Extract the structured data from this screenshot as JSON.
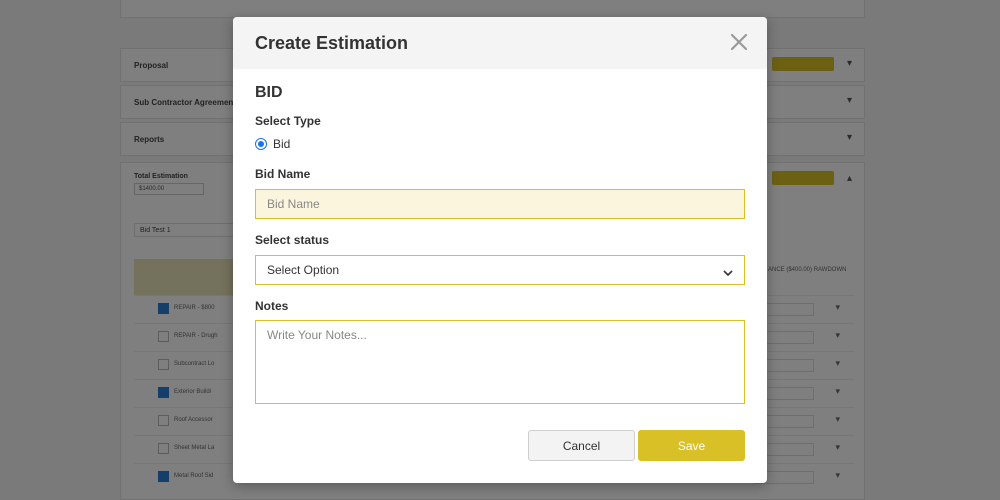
{
  "modal": {
    "title": "Create Estimation",
    "section_title": "BID",
    "type_label": "Select Type",
    "type_option": "Bid",
    "bid_name_label": "Bid Name",
    "bid_name_placeholder": "Bid Name",
    "status_label": "Select status",
    "status_selected": "Select Option",
    "notes_label": "Notes",
    "notes_placeholder": "Write Your Notes...",
    "cancel_label": "Cancel",
    "save_label": "Save"
  },
  "background": {
    "sections": [
      "Proposal",
      "Sub Contractor Agreement",
      "Reports"
    ],
    "total_estimation_label": "Total Estimation",
    "total_estimation_value": "$1400.00",
    "bid_test": "Bid Test 1",
    "right_header": "ANCE ($400.00) RAWDOWN",
    "rows": [
      {
        "label": "REPAIR - $800",
        "checked": true
      },
      {
        "label": "REPAIR - Drugh",
        "checked": false
      },
      {
        "label": "Subcontract Lo",
        "checked": false
      },
      {
        "label": "Exterior Buildi",
        "checked": true
      },
      {
        "label": "Roof Accessor",
        "checked": false
      },
      {
        "label": "Sheet Metal La",
        "checked": false
      },
      {
        "label": "Metal Roof Sid",
        "checked": true
      }
    ]
  },
  "colors": {
    "accent": "#d9c026",
    "radio": "#1a73e8",
    "overlay": "rgba(0,0,0,0.5)"
  }
}
